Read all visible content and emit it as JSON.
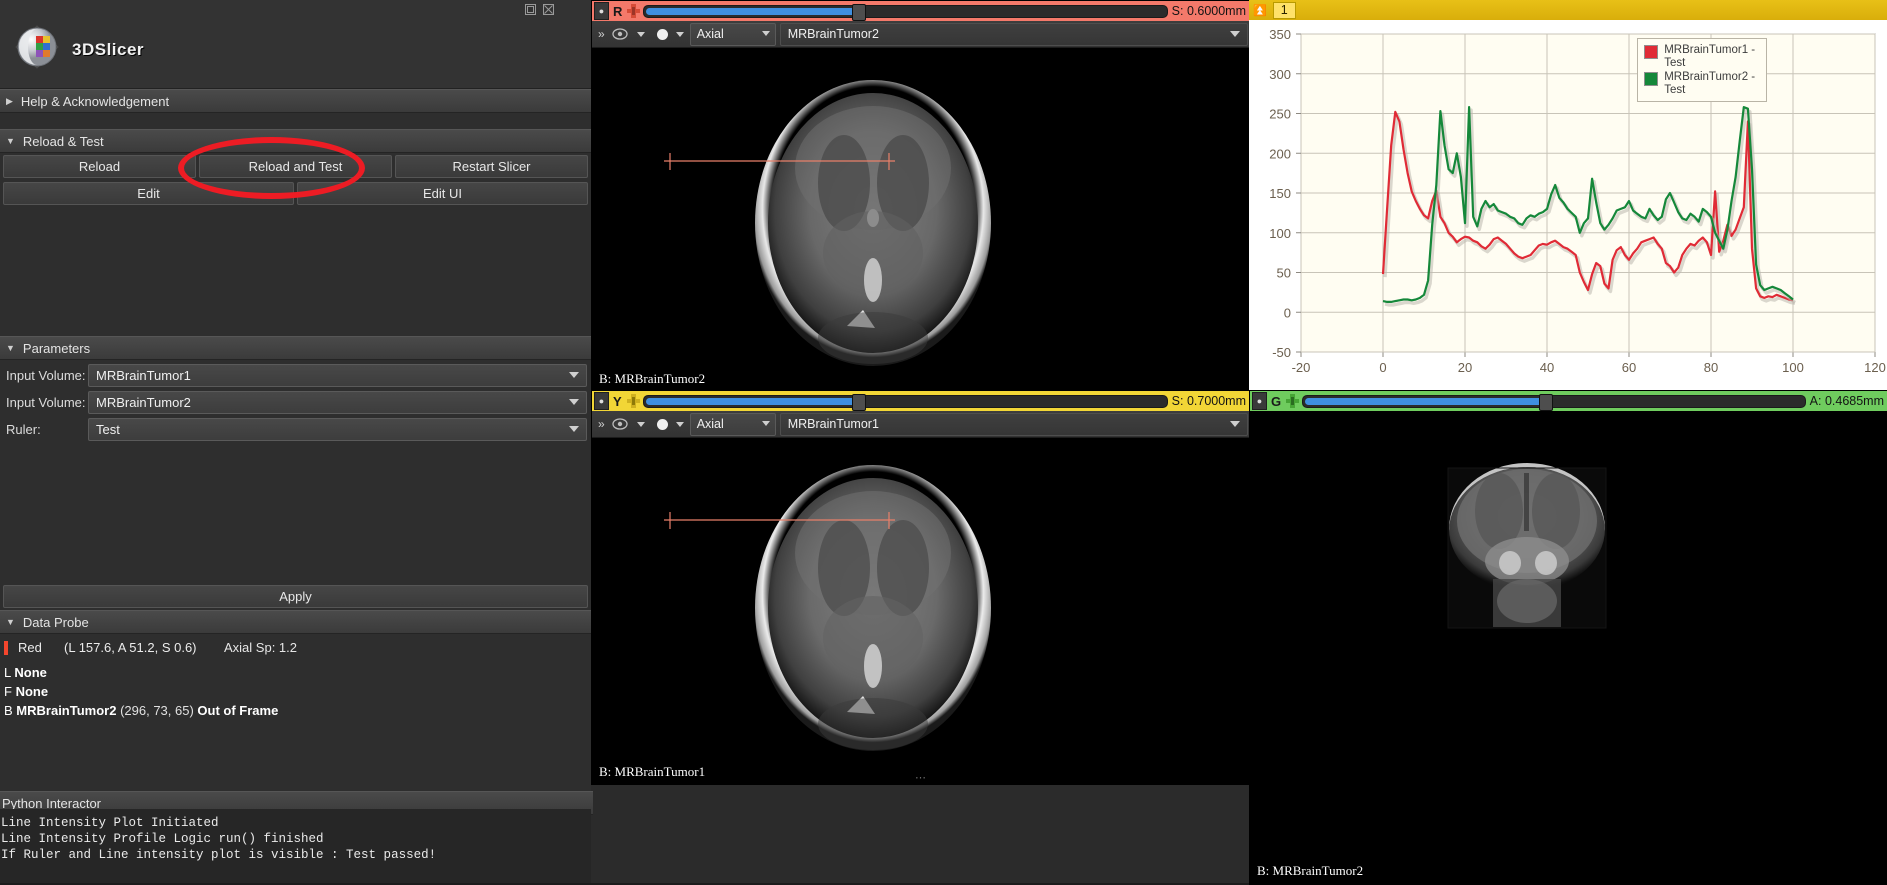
{
  "app": {
    "name": "3DSlicer"
  },
  "window_controls": {
    "restore": "restore-icon",
    "close": "close-icon"
  },
  "left_panel": {
    "help_section": {
      "label": "Help & Acknowledgement",
      "expanded": false
    },
    "reload_section": {
      "label": "Reload & Test",
      "expanded": true,
      "buttons": [
        "Reload",
        "Reload and Test",
        "Restart Slicer"
      ],
      "edit_buttons": [
        "Edit",
        "Edit UI"
      ]
    },
    "parameters_section": {
      "label": "Parameters",
      "expanded": true,
      "fields": [
        {
          "label": "Input Volume:",
          "value": "MRBrainTumor1"
        },
        {
          "label": "Input Volume:",
          "value": "MRBrainTumor2"
        },
        {
          "label": "Ruler:",
          "value": "Test"
        }
      ],
      "apply_label": "Apply"
    },
    "data_probe": {
      "label": "Data Probe",
      "expanded": true,
      "slice_name": "Red",
      "coords": "(L 157.6, A 51.2, S 0.6)",
      "spacing": "Axial Sp: 1.2",
      "layers": [
        {
          "key": "L",
          "value": "None",
          "extra": "",
          "status": ""
        },
        {
          "key": "F",
          "value": "None",
          "extra": "",
          "status": ""
        },
        {
          "key": "B",
          "value": "MRBrainTumor2",
          "extra": "(296,  73,  65)",
          "status": "Out of Frame"
        }
      ]
    },
    "python_interactor": {
      "label": "Python Interactor",
      "output": [
        "Line Intensity Plot Initiated",
        "Line Intensity Profile Logic run() finished",
        "If Ruler and Line intensity plot is visible : Test passed!"
      ]
    }
  },
  "slice_views": [
    {
      "id": "red",
      "letter": "R",
      "color": "#f4796a",
      "offset_label": "S: 0.6000mm",
      "orientation": "Axial",
      "node": "MRBrainTumor2",
      "corner_label": "B: MRBrainTumor2",
      "slider_pct": 52
    },
    {
      "id": "yellow",
      "letter": "Y",
      "color": "#f2d636",
      "offset_label": "S: 0.7000mm",
      "orientation": "Axial",
      "node": "MRBrainTumor1",
      "corner_label": "B: MRBrainTumor1",
      "slider_pct": 52
    },
    {
      "id": "green",
      "letter": "G",
      "color": "#6fcc5e",
      "offset_label": "A: 0.4685mm",
      "orientation": "Coronal",
      "node": "MRBrainTumor2",
      "corner_label": "B: MRBrainTumor2",
      "slider_pct": 48
    }
  ],
  "chart_panel": {
    "view_number": "1",
    "pin_icon": "pin-icon"
  },
  "colors": {
    "series1": "#e02b36",
    "series2": "#15883a",
    "red_slice": "#f4796a",
    "yellow_slice": "#f2d636",
    "green_slice": "#6fcc5e",
    "annotation": "#ed1c24",
    "plot_bg": "#fffdf2",
    "grid": "#c8c4b8"
  },
  "chart_data": {
    "type": "line",
    "title": "",
    "xlabel": "",
    "ylabel": "",
    "xlim": [
      -20,
      120
    ],
    "ylim": [
      -50,
      350
    ],
    "xticks": [
      -20,
      0,
      20,
      40,
      60,
      80,
      100,
      120
    ],
    "yticks": [
      -50,
      0,
      50,
      100,
      150,
      200,
      250,
      300,
      350
    ],
    "grid": true,
    "legend_position": "top-right",
    "legend": [
      "MRBrainTumor1 - Test",
      "MRBrainTumor2 - Test"
    ],
    "x": [
      0,
      1,
      2,
      3,
      4,
      5,
      6,
      7,
      8,
      9,
      10,
      11,
      12,
      13,
      14,
      15,
      16,
      17,
      18,
      19,
      20,
      21,
      22,
      23,
      24,
      25,
      26,
      27,
      28,
      29,
      30,
      31,
      32,
      33,
      34,
      35,
      36,
      37,
      38,
      39,
      40,
      41,
      42,
      43,
      44,
      45,
      46,
      47,
      48,
      49,
      50,
      51,
      52,
      53,
      54,
      55,
      56,
      57,
      58,
      59,
      60,
      61,
      62,
      63,
      64,
      65,
      66,
      67,
      68,
      69,
      70,
      71,
      72,
      73,
      74,
      75,
      76,
      77,
      78,
      79,
      80,
      81,
      82,
      83,
      84,
      85,
      86,
      87,
      88,
      89,
      90,
      91,
      92,
      93,
      94,
      95,
      96,
      97,
      98,
      99,
      100
    ],
    "series": [
      {
        "name": "MRBrainTumor1 - Test",
        "color": "#e02b36",
        "values": [
          48,
          130,
          210,
          252,
          240,
          205,
          175,
          152,
          140,
          130,
          122,
          118,
          140,
          153,
          120,
          112,
          100,
          95,
          88,
          92,
          95,
          94,
          90,
          88,
          83,
          80,
          85,
          92,
          94,
          90,
          86,
          80,
          74,
          70,
          68,
          70,
          72,
          78,
          84,
          86,
          85,
          88,
          90,
          86,
          82,
          80,
          76,
          72,
          50,
          38,
          28,
          48,
          62,
          58,
          36,
          30,
          66,
          78,
          82,
          72,
          66,
          74,
          80,
          88,
          90,
          92,
          94,
          86,
          80,
          62,
          58,
          50,
          56,
          72,
          80,
          86,
          84,
          90,
          94,
          88,
          72,
          152,
          76,
          90,
          110,
          96,
          104,
          118,
          132,
          240,
          80,
          30,
          20,
          18,
          20,
          19,
          22,
          20,
          18,
          16,
          15
        ]
      },
      {
        "name": "MRBrainTumor2 - Test",
        "color": "#15883a",
        "values": [
          14,
          13,
          13,
          14,
          15,
          16,
          16,
          15,
          16,
          18,
          22,
          40,
          110,
          160,
          253,
          210,
          180,
          175,
          200,
          170,
          112,
          258,
          120,
          108,
          130,
          140,
          132,
          136,
          128,
          126,
          124,
          120,
          118,
          112,
          110,
          118,
          122,
          120,
          124,
          126,
          130,
          148,
          160,
          144,
          138,
          130,
          125,
          120,
          100,
          112,
          118,
          168,
          138,
          112,
          104,
          110,
          118,
          128,
          130,
          132,
          140,
          128,
          124,
          120,
          118,
          130,
          122,
          116,
          120,
          142,
          150,
          138,
          126,
          118,
          116,
          124,
          120,
          114,
          130,
          126,
          120,
          100,
          90,
          80,
          104,
          140,
          170,
          215,
          258,
          256,
          180,
          60,
          34,
          28,
          30,
          32,
          30,
          28,
          24,
          20,
          16
        ]
      }
    ]
  }
}
